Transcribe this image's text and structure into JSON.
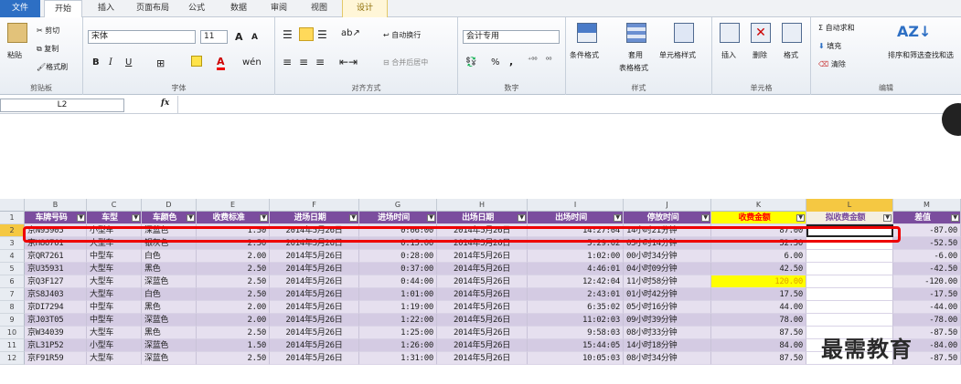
{
  "ribbon_tabs": [
    "文件",
    "开始",
    "插入",
    "页面布局",
    "公式",
    "数据",
    "审阅",
    "视图",
    "设计"
  ],
  "clipboard": {
    "paste": "粘贴",
    "cut": "剪切",
    "copy": "复制",
    "format_painter": "格式刷",
    "label": "剪贴板"
  },
  "font": {
    "name": "宋体",
    "size": "11",
    "bold": "B",
    "italic": "I",
    "underline": "U",
    "grow": "A",
    "shrink": "A",
    "label": "字体",
    "ext": "wén"
  },
  "alignment": {
    "wrap": "自动换行",
    "merge": "合并后居中",
    "label": "对齐方式"
  },
  "number": {
    "format": "会计专用",
    "percent": "%",
    "comma": ",",
    "label": "数字"
  },
  "styles": {
    "conditional": "条件格式",
    "table1": "套用",
    "table2": "表格格式",
    "cell_styles": "单元格样式",
    "label": "样式"
  },
  "cells": {
    "insert": "插入",
    "delete": "删除",
    "format": "格式",
    "label": "单元格"
  },
  "editing": {
    "autosum": "Σ 自动求和",
    "fill": "填充",
    "clear": "清除",
    "sort": "排序和筛选",
    "find": "查找和选",
    "label": "编辑"
  },
  "formula_bar": {
    "name_box": "L2",
    "fx": "fx",
    "formula": ""
  },
  "columns": [
    "B",
    "C",
    "D",
    "E",
    "F",
    "G",
    "H",
    "I",
    "J",
    "K",
    "L",
    "M"
  ],
  "headers": [
    "车牌号码",
    "车型",
    "车颜色",
    "收费标准",
    "进场日期",
    "进场时间",
    "出场日期",
    "出场时间",
    "停放时间",
    "收费金额",
    "拟收费金额",
    "差值"
  ],
  "rows": [
    {
      "n": "2",
      "v": [
        "京N95905",
        "小型车",
        "深蓝色",
        "1.50",
        "2014年5月26日",
        "0:06:00",
        "2014年5月26日",
        "14:27:04",
        "14小时21分钟",
        "87.00",
        "",
        "-87.00"
      ]
    },
    {
      "n": "3",
      "v": [
        "京H86761",
        "大型车",
        "银灰色",
        "2.50",
        "2014年5月26日",
        "0:15:00",
        "2014年5月26日",
        "5:29:02",
        "05小时14分钟",
        "52.50",
        "",
        "-52.50"
      ]
    },
    {
      "n": "4",
      "v": [
        "京QR7261",
        "中型车",
        "白色",
        "2.00",
        "2014年5月26日",
        "0:28:00",
        "2014年5月26日",
        "1:02:00",
        "00小时34分钟",
        "6.00",
        "",
        "-6.00"
      ]
    },
    {
      "n": "5",
      "v": [
        "京U35931",
        "大型车",
        "黑色",
        "2.50",
        "2014年5月26日",
        "0:37:00",
        "2014年5月26日",
        "4:46:01",
        "04小时09分钟",
        "42.50",
        "",
        "-42.50"
      ]
    },
    {
      "n": "6",
      "v": [
        "京Q3F127",
        "大型车",
        "深蓝色",
        "2.50",
        "2014年5月26日",
        "0:44:00",
        "2014年5月26日",
        "12:42:04",
        "11小时58分钟",
        "120.00",
        "",
        "-120.00"
      ]
    },
    {
      "n": "7",
      "v": [
        "京S8J403",
        "大型车",
        "白色",
        "2.50",
        "2014年5月26日",
        "1:01:00",
        "2014年5月26日",
        "2:43:01",
        "01小时42分钟",
        "17.50",
        "",
        "-17.50"
      ]
    },
    {
      "n": "8",
      "v": [
        "京DI7294",
        "中型车",
        "黑色",
        "2.00",
        "2014年5月26日",
        "1:19:00",
        "2014年5月26日",
        "6:35:02",
        "05小时16分钟",
        "44.00",
        "",
        "-44.00"
      ]
    },
    {
      "n": "9",
      "v": [
        "京J03T05",
        "中型车",
        "深蓝色",
        "2.00",
        "2014年5月26日",
        "1:22:00",
        "2014年5月26日",
        "11:02:03",
        "09小时39分钟",
        "78.00",
        "",
        "-78.00"
      ]
    },
    {
      "n": "10",
      "v": [
        "京W34039",
        "大型车",
        "黑色",
        "2.50",
        "2014年5月26日",
        "1:25:00",
        "2014年5月26日",
        "9:58:03",
        "08小时33分钟",
        "87.50",
        "",
        "-87.50"
      ]
    },
    {
      "n": "11",
      "v": [
        "京L31P52",
        "小型车",
        "深蓝色",
        "1.50",
        "2014年5月26日",
        "1:26:00",
        "2014年5月26日",
        "15:44:05",
        "14小时18分钟",
        "84.00",
        "",
        "-84.00"
      ]
    },
    {
      "n": "12",
      "v": [
        "京F91R59",
        "大型车",
        "深蓝色",
        "2.50",
        "2014年5月26日",
        "1:31:00",
        "2014年5月26日",
        "10:05:03",
        "08小时34分钟",
        "87.50",
        "",
        "-87.50"
      ]
    }
  ],
  "header_row_num": "1",
  "highlight": {
    "row_index": 4,
    "color": "#ffff00",
    "text_color": "#e0a000"
  },
  "watermark": "最需教育",
  "colors": {
    "header_bg": "#7b4d9e",
    "band_a": "#e6e0ef",
    "band_b": "#d4cbe3",
    "k_header_bg": "#ffff00",
    "k_header_fg": "#ff0000"
  }
}
